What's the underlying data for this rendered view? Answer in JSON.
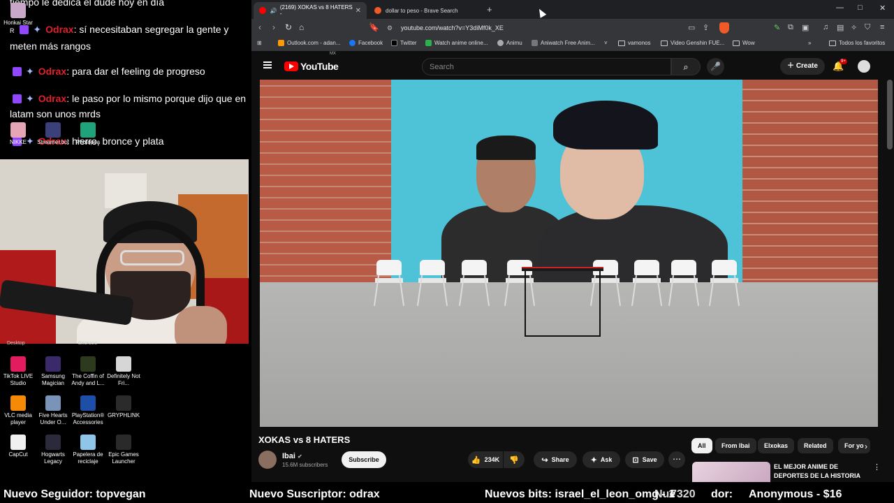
{
  "chat": {
    "lines": [
      {
        "user": "",
        "text": "tiempo le dedica el dude hoy en día"
      },
      {
        "user": "Odrax",
        "text": ": sí necesitaban segregar la gente y meten más rangos"
      },
      {
        "user": "Odrax",
        "text": ": para dar el feeling de progreso"
      },
      {
        "user": "Odrax",
        "text": ": le paso por lo mismo porque dijo que en latam son unos mrds"
      },
      {
        "user": "Odrax",
        "text": ": hierro, bronce y plata"
      }
    ],
    "partial_line_prefix": "R"
  },
  "desktop_top": {
    "honkai": "Honkai Star",
    "nikke": "NIKKE",
    "streamerbot": "Streamer.bot",
    "photopea": "Photopea"
  },
  "desktop_clipped": {
    "a": "Desktop",
    "b": "Encrucio"
  },
  "desktop_icons": [
    {
      "label": "TikTok LIVE Studio",
      "color": "#e31b5f"
    },
    {
      "label": "Samsung Magician",
      "color": "#3a2a6a"
    },
    {
      "label": "The Coffin of Andy and L...",
      "color": "#2d3a1e"
    },
    {
      "label": "Definitely Not Fri...",
      "color": "#d6d6d6"
    },
    {
      "label": "VLC media player",
      "color": "#f58a07"
    },
    {
      "label": "Five Hearts Under O...",
      "color": "#7a93b8"
    },
    {
      "label": "PlayStation® Accessories",
      "color": "#1e4fa8"
    },
    {
      "label": "GRYPHLINK",
      "color": "#2b2b2b"
    },
    {
      "label": "CapCut",
      "color": "#f0f0f0"
    },
    {
      "label": "Hogwarts Legacy",
      "color": "#2a2a3a"
    },
    {
      "label": "Papelera de reciclaje",
      "color": "#8ec5e8"
    },
    {
      "label": "Epic Games Launcher",
      "color": "#2a2a2a"
    }
  ],
  "browser": {
    "tabs": [
      {
        "label": "(2169) XOKAS vs 8 HATERS -",
        "active": true
      },
      {
        "label": "dollar to peso - Brave Search",
        "active": false
      }
    ],
    "url": "youtube.com/watch?v=Y3diMf0k_XE",
    "bookmarks": [
      "Outlook.com - adan...",
      "Facebook",
      "Twitter",
      "Watch anime online...",
      "Animu",
      "Aniwatch Free Anim...",
      "vamonos",
      "Video Genshin FUE...",
      "Wow"
    ],
    "all_bookmarks": "Todos los favoritos"
  },
  "youtube": {
    "logo": "YouTube",
    "region": "MX",
    "search_placeholder": "Search",
    "create_label": "Create",
    "notif_count": "9+",
    "video_title": "XOKAS vs 8 HATERS",
    "channel_name": "Ibai",
    "subscribers": "15.6M subscribers",
    "subscribe_label": "Subscribe",
    "likes": "234K",
    "share_label": "Share",
    "ask_label": "Ask",
    "save_label": "Save",
    "chips": [
      "All",
      "From Ibai",
      "Elxokas",
      "Related",
      "For yo"
    ],
    "rec_title": "EL MEJOR ANIME DE DEPORTES DE LA HISTORIA"
  },
  "ticker": {
    "follower": "Nuevo Seguidor: topvegan",
    "subscriber": "Nuevo Suscriptor: odrax",
    "bits": "Nuevos bits: israel_el_leon_omg - 1",
    "overlap": "Nue",
    "overlap_tail": "7320",
    "donor": "Anonymous - $16",
    "donor_prefix": "dor:"
  }
}
